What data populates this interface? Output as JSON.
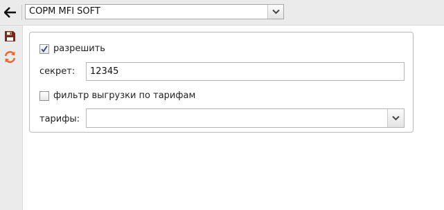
{
  "toolbar": {
    "back_icon": "arrow-left-icon",
    "company_select": {
      "value": "СОРМ MFI SOFT"
    }
  },
  "sidebar": {
    "save_icon": "floppy-disk-icon",
    "refresh_icon": "refresh-icon",
    "accent_color": "#e8692b",
    "save_color": "#7a2a12"
  },
  "form": {
    "allow": {
      "label": "разрешить",
      "checked": true
    },
    "secret": {
      "label": "секрет:",
      "value": "12345"
    },
    "tariff_filter": {
      "label": "фильтр выгрузки по тарифам",
      "checked": false
    },
    "tariffs": {
      "label": "тарифы:",
      "value": ""
    }
  }
}
